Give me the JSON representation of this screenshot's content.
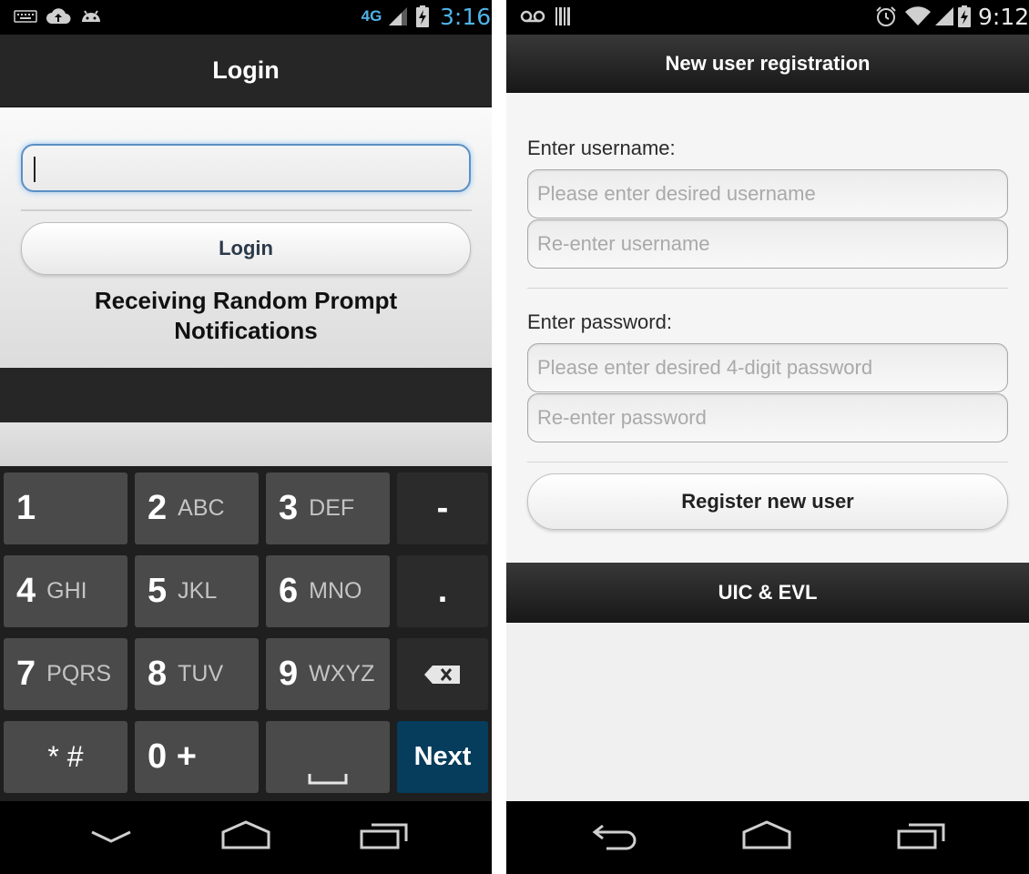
{
  "left": {
    "statusbar": {
      "time": "3:16",
      "network_label": "4G",
      "icons": [
        "keyboard-icon",
        "cloud-upload-icon",
        "android-icon",
        "lte-icon",
        "signal-icon",
        "battery-charging-icon"
      ]
    },
    "header": {
      "title": "Login"
    },
    "form": {
      "input_value": "",
      "button_label": "Login",
      "status_text": "Receiving Random Prompt Notifications"
    },
    "keyboard": {
      "keys": {
        "k1": {
          "num": "1",
          "letters": ""
        },
        "k2": {
          "num": "2",
          "letters": "ABC"
        },
        "k3": {
          "num": "3",
          "letters": "DEF"
        },
        "k4": {
          "num": "4",
          "letters": "GHI"
        },
        "k5": {
          "num": "5",
          "letters": "JKL"
        },
        "k6": {
          "num": "6",
          "letters": "MNO"
        },
        "k7": {
          "num": "7",
          "letters": "PQRS"
        },
        "k8": {
          "num": "8",
          "letters": "TUV"
        },
        "k9": {
          "num": "9",
          "letters": "WXYZ"
        },
        "kstar": {
          "num": "* #"
        },
        "k0": {
          "num": "0 +"
        },
        "dash": "-",
        "dot": ".",
        "next": "Next"
      }
    },
    "navbar": {
      "icons": [
        "back-chevron-icon",
        "home-icon",
        "recent-apps-icon"
      ]
    }
  },
  "right": {
    "statusbar": {
      "time": "9:12",
      "icons": [
        "voicemail-icon",
        "barcode-icon",
        "alarm-icon",
        "wifi-icon",
        "signal-icon",
        "battery-charging-icon"
      ]
    },
    "header": {
      "title": "New user registration"
    },
    "form": {
      "username_label": "Enter username:",
      "username_placeholder": "Please enter desired username",
      "username_confirm_placeholder": "Re-enter username",
      "password_label": "Enter password:",
      "password_placeholder": "Please enter desired 4-digit password",
      "password_confirm_placeholder": "Re-enter password",
      "register_button": "Register new user"
    },
    "footer": {
      "text": "UIC & EVL"
    },
    "navbar": {
      "icons": [
        "back-arrow-icon",
        "home-icon",
        "recent-apps-icon"
      ]
    }
  },
  "colors": {
    "focus_border": "#5b8fc4",
    "next_key": "#063c5c",
    "status_time_left": "#4fb3e8"
  }
}
